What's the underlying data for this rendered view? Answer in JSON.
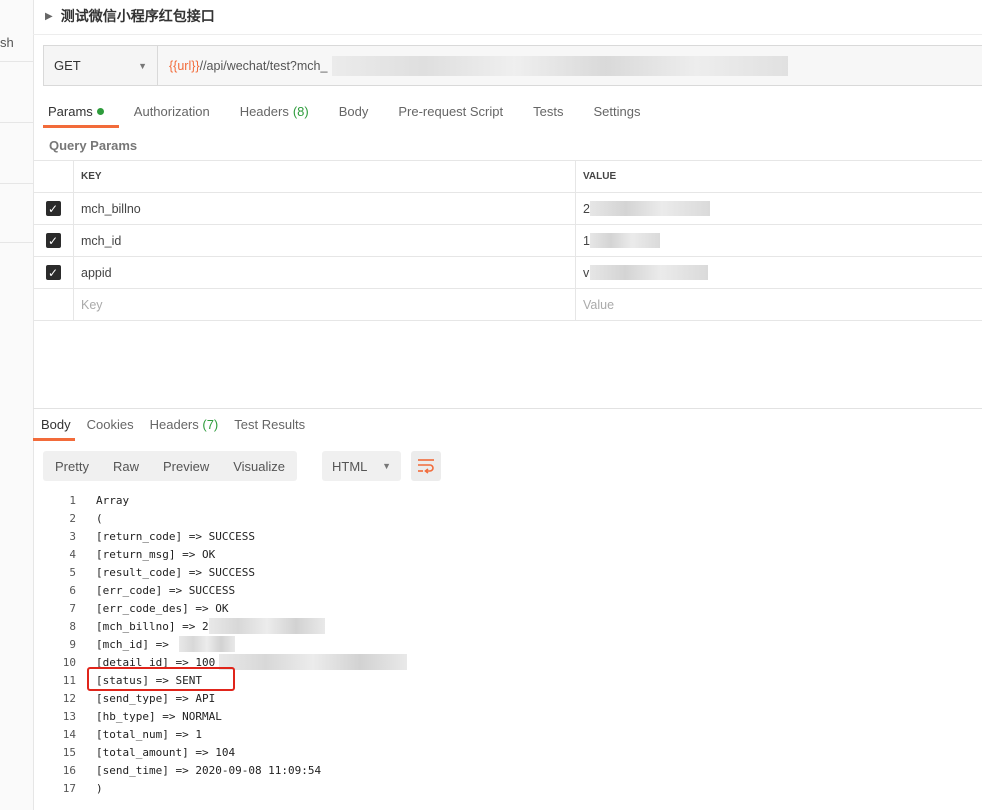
{
  "sidebar": {
    "text_fragment": "sh"
  },
  "request": {
    "title": "测试微信小程序红包接口",
    "method": "GET",
    "url_variable": "{{url}}",
    "url_path": "//api/wechat/test?mch_"
  },
  "request_tabs": [
    {
      "label": "Params",
      "badge": "",
      "active": true
    },
    {
      "label": "Authorization",
      "badge": ""
    },
    {
      "label": "Headers",
      "badge": "(8)"
    },
    {
      "label": "Body",
      "badge": ""
    },
    {
      "label": "Pre-request Script",
      "badge": ""
    },
    {
      "label": "Tests",
      "badge": ""
    },
    {
      "label": "Settings",
      "badge": ""
    }
  ],
  "query_params": {
    "title": "Query Params",
    "key_header": "KEY",
    "value_header": "VALUE",
    "rows": [
      {
        "checked": true,
        "key": "mch_billno",
        "value": "2"
      },
      {
        "checked": true,
        "key": "mch_id",
        "value": "1"
      },
      {
        "checked": true,
        "key": "appid",
        "value": "v"
      }
    ],
    "key_placeholder": "Key",
    "value_placeholder": "Value"
  },
  "response_tabs": [
    {
      "label": "Body",
      "badge": "",
      "active": true
    },
    {
      "label": "Cookies",
      "badge": ""
    },
    {
      "label": "Headers",
      "badge": "(7)"
    },
    {
      "label": "Test Results",
      "badge": ""
    }
  ],
  "view_modes": [
    "Pretty",
    "Raw",
    "Preview",
    "Visualize"
  ],
  "format": "HTML",
  "code_lines": [
    {
      "n": "1",
      "t": "Array"
    },
    {
      "n": "2",
      "t": "("
    },
    {
      "n": "3",
      "t": "[return_code] => SUCCESS"
    },
    {
      "n": "4",
      "t": "[return_msg] => OK"
    },
    {
      "n": "5",
      "t": "[result_code] => SUCCESS"
    },
    {
      "n": "6",
      "t": "[err_code] => SUCCESS"
    },
    {
      "n": "7",
      "t": "[err_code_des] => OK"
    },
    {
      "n": "8",
      "t": "[mch_billno] => 2"
    },
    {
      "n": "9",
      "t": "[mch_id] => "
    },
    {
      "n": "10",
      "t": "[detail_id] => 100"
    },
    {
      "n": "11",
      "t": "[status] => SENT"
    },
    {
      "n": "12",
      "t": "[send_type] => API"
    },
    {
      "n": "13",
      "t": "[hb_type] => NORMAL"
    },
    {
      "n": "14",
      "t": "[total_num] => 1"
    },
    {
      "n": "15",
      "t": "[total_amount] => 104"
    },
    {
      "n": "16",
      "t": "[send_time] => 2020-09-08 11:09:54"
    },
    {
      "n": "17",
      "t": ")"
    }
  ]
}
